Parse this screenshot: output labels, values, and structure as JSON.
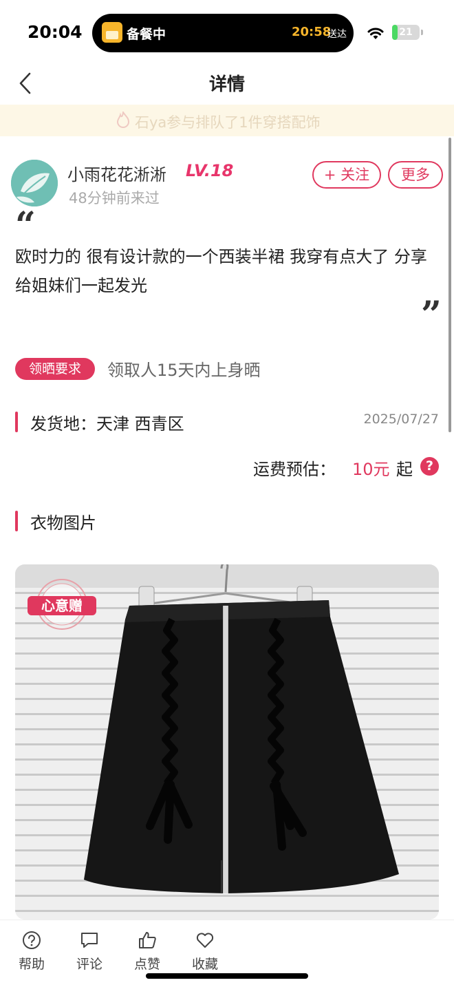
{
  "status_bar": {
    "time": "20:04",
    "activity_label": "备餐中",
    "activity_eta": "20:58",
    "activity_eta_suffix": "送达",
    "battery": "21",
    "battery_level": 0.21
  },
  "nav": {
    "title": "详情"
  },
  "banner": {
    "text": "石ya参与排队了1件穿搭配饰"
  },
  "post": {
    "user_name": "小雨花花淅淅",
    "user_level": "LV.18",
    "last_seen": "48分钟前来过",
    "follow_label": "+ 关注",
    "more_label": "更多",
    "description": "欧时力的 很有设计款的一个西装半裙 我穿有点大了 分享给姐妹们一起发光",
    "requirement_badge": "领晒要求",
    "requirement_text": "领取人15天内上身晒",
    "ship_from": "发货地：天津 西青区",
    "date": "2025/07/27",
    "fee_label": "运费预估：",
    "fee_value": "10元",
    "fee_suffix": "起",
    "fee_help": "?",
    "photo_section": "衣物图片",
    "stamp": "心意赠"
  },
  "bottom_tabs": [
    {
      "label": "帮助",
      "icon": "help-icon"
    },
    {
      "label": "评论",
      "icon": "comment-icon"
    },
    {
      "label": "点赞",
      "icon": "thumbs-up-icon"
    },
    {
      "label": "收藏",
      "icon": "heart-icon"
    }
  ],
  "colors": {
    "accent": "#e0385e",
    "banner_bg": "#fdf7e6",
    "eta": "#f7b52b"
  }
}
